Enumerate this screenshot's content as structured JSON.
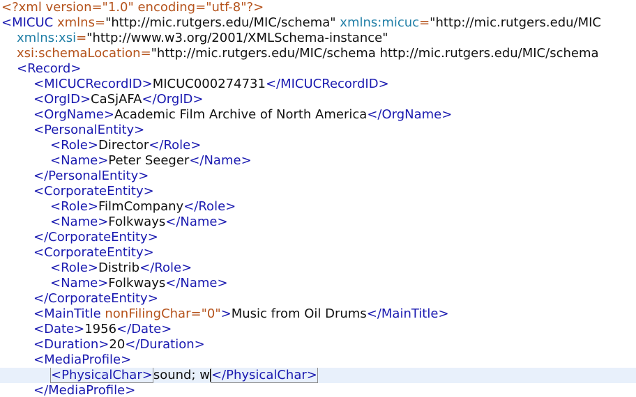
{
  "editor": {
    "pi": "<?xml version=\"1.0\" encoding=\"utf-8\"?>",
    "root": {
      "name": "MICUC",
      "xmlns_attr": "xmlns",
      "xmlns_value": "\"http://mic.rutgers.edu/MIC/schema\"",
      "micuc_attr": "xmlns:micuc",
      "micuc_value": "\"http://mic.rutgers.edu/MIC",
      "xsi_attr": "xmlns:xsi",
      "xsi_value": "\"http://www.w3.org/2001/XMLSchema-instance\"",
      "schemaloc_attr": "xsi:schemaLocation",
      "schemaloc_value": "\"http://mic.rutgers.edu/MIC/schema http://mic.rutgers.edu/MIC/schema"
    },
    "record_tag": "Record",
    "recordid": {
      "tag": "MICUCRecordID",
      "value": "MICUC000274731"
    },
    "orgid": {
      "tag": "OrgID",
      "value": "CaSjAFA"
    },
    "orgname": {
      "tag": "OrgName",
      "value": "Academic Film Archive of North America"
    },
    "personal": {
      "tag": "PersonalEntity",
      "role_tag": "Role",
      "role": "Director",
      "name_tag": "Name",
      "name": "Peter Seeger"
    },
    "corporate1": {
      "tag": "CorporateEntity",
      "role_tag": "Role",
      "role": "FilmCompany",
      "name_tag": "Name",
      "name": "Folkways"
    },
    "corporate2": {
      "tag": "CorporateEntity",
      "role_tag": "Role",
      "role": "Distrib",
      "name_tag": "Name",
      "name": "Folkways"
    },
    "maintitle": {
      "tag": "MainTitle",
      "attr": "nonFilingChar",
      "attr_value": "\"0\"",
      "value": "Music from Oil Drums"
    },
    "date": {
      "tag": "Date",
      "value": "1956"
    },
    "duration": {
      "tag": "Duration",
      "value": "20"
    },
    "mediaprofile_tag": "MediaProfile",
    "physicalchar": {
      "tag": "PhysicalChar",
      "value": "sound; w"
    }
  },
  "colors": {
    "tag": "#1a1ab0",
    "attribute": "#b5531c",
    "namespace": "#1f7ea6",
    "text": "#111111",
    "current_line": "#e8f0fb"
  }
}
